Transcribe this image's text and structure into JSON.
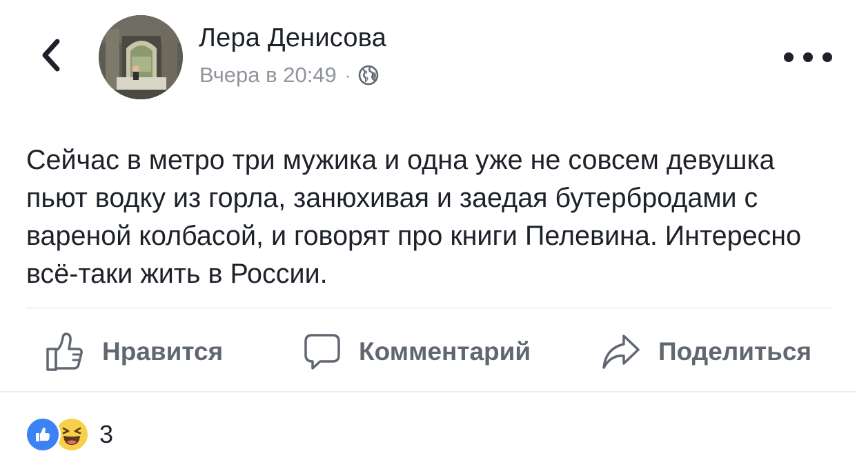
{
  "post": {
    "author": "Лера Денисова",
    "timestamp": "Вчера в 20:49",
    "meta_separator": "·",
    "privacy_icon": "globe-icon",
    "text": "Сейчас в метро три мужика и одна уже не совсем девушка пьют водку из горла, занюхивая и заедая бутербродами с вареной колбасой, и говорят про книги Пелевина. Интересно всё-таки жить в России."
  },
  "nav": {
    "back_icon": "chevron-left-icon",
    "more_icon": "more-horizontal-icon"
  },
  "actions": {
    "like_label": "Нравится",
    "comment_label": "Комментарий",
    "share_label": "Поделиться"
  },
  "reactions": {
    "types": [
      "like",
      "haha"
    ],
    "count": "3"
  },
  "colors": {
    "text": "#1d2129",
    "secondary": "#90949c",
    "action": "#606770",
    "like_blue": "#3b82f4",
    "haha_yellow": "#f7d04a"
  }
}
